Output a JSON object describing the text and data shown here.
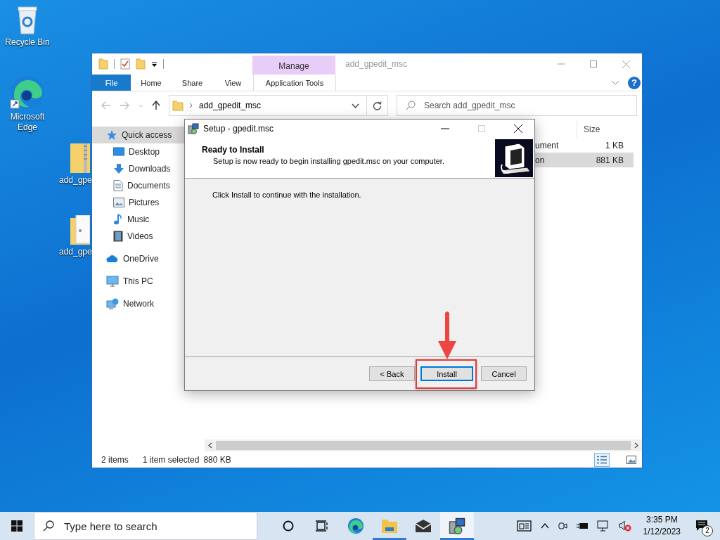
{
  "desktop_icons": [
    {
      "kind": "recycle",
      "label": "Recycle Bin"
    },
    {
      "kind": "edge",
      "label": "Microsoft Edge"
    },
    {
      "kind": "zip",
      "label": "add_gpe"
    },
    {
      "kind": "folder",
      "label": "add_gpe"
    }
  ],
  "explorer": {
    "title": "add_gpedit_msc",
    "context_tab": "Manage",
    "ribbon_tabs": [
      {
        "label": "File",
        "kind": "file"
      },
      {
        "label": "Home",
        "kind": "plain"
      },
      {
        "label": "Share",
        "kind": "plain"
      },
      {
        "label": "View",
        "kind": "plain"
      },
      {
        "label": "Application Tools",
        "kind": "context"
      }
    ],
    "help": "?",
    "address": "add_gpedit_msc",
    "search": {
      "placeholder": "Search add_gpedit_msc"
    },
    "nav": [
      {
        "label": "Quick access",
        "kind": "star",
        "selected": true,
        "children": [
          {
            "label": "Desktop",
            "kind": "desktop",
            "selected": false
          },
          {
            "label": "Downloads",
            "kind": "download",
            "selected": false
          },
          {
            "label": "Documents",
            "kind": "document",
            "selected": false
          },
          {
            "label": "Pictures",
            "kind": "picture",
            "selected": false
          },
          {
            "label": "Music",
            "kind": "music",
            "selected": false
          },
          {
            "label": "Videos",
            "kind": "video",
            "selected": false
          }
        ]
      },
      {
        "label": "OneDrive",
        "kind": "cloud",
        "selected": false
      },
      {
        "label": "This PC",
        "kind": "pc",
        "selected": false
      },
      {
        "label": "Network",
        "kind": "network",
        "selected": false
      }
    ],
    "columns": [
      "Size"
    ],
    "rows": [
      {
        "name": "ument",
        "size": "1 KB",
        "selected": false
      },
      {
        "name": "on",
        "size": "881 KB",
        "selected": true
      }
    ],
    "status_bar": [
      "2 items",
      "1 item selected",
      "880 KB"
    ],
    "view_buttons": [
      {
        "kind": "details",
        "selected": true
      },
      {
        "kind": "tiles",
        "selected": false
      }
    ]
  },
  "dialog": {
    "title": "Setup - gpedit.msc",
    "heading": "Ready to Install",
    "subheading": "Setup is now ready to begin installing gpedit.msc on your computer.",
    "body": "Click Install to continue with the installation.",
    "buttons": [
      {
        "label": "< Back",
        "default": false,
        "highlighted": false
      },
      {
        "label": "Install",
        "default": true,
        "highlighted": true
      },
      {
        "label": "Cancel",
        "default": false,
        "highlighted": false
      }
    ]
  },
  "taskbar": {
    "search": {
      "placeholder": "Type here to search"
    },
    "apps": [
      {
        "kind": "edge",
        "running": false,
        "active": false
      },
      {
        "kind": "explorer",
        "running": true,
        "active": false
      },
      {
        "kind": "mail",
        "running": false,
        "active": false
      },
      {
        "kind": "setup",
        "running": true,
        "active": true
      }
    ],
    "volume": {
      "muted": true
    },
    "clock": {
      "time": "3:35 PM",
      "date": "1/12/2023"
    },
    "notifications": {
      "count": "2"
    }
  }
}
